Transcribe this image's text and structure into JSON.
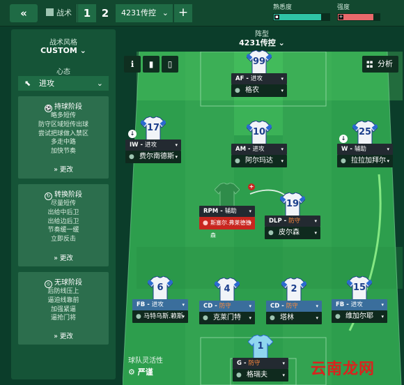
{
  "topbar": {
    "back_icon": "«",
    "tactics_tab": "战术",
    "tactic_slots": [
      "1",
      "2"
    ],
    "tactic_name": "4231传控",
    "add_label": "+",
    "familiarity_label": "熟悉度",
    "intensity_label": "强度",
    "familiarity_level": 0.85,
    "intensity_level": 0.85,
    "colors": {
      "familiarity": "#2fc4a6",
      "intensity": "#e8696b"
    }
  },
  "left_panel": {
    "style_label": "战术风格",
    "style_value": "CUSTOM",
    "mentality_label": "心态",
    "mentality_value": "进攻",
    "phases": [
      {
        "title": "持球阶段",
        "icon": "possession-icon",
        "items": [
          "略多短传",
          "防守区域短传出球",
          "尝试把球做入禁区",
          "多走中路",
          "加快节奏"
        ],
        "more": "更改"
      },
      {
        "title": "转换阶段",
        "icon": "transition-icon",
        "items": [
          "尽量短传",
          "出给中后卫",
          "出给边后卫",
          "节奏缓一缓",
          "立即反击"
        ],
        "more": "更改"
      },
      {
        "title": "无球阶段",
        "icon": "out-of-possession-icon",
        "items": [
          "后防线压上",
          "逼迫线靠前",
          "加强紧逼",
          "逼抢门将"
        ],
        "more": "更改"
      }
    ]
  },
  "pitch": {
    "formation_label": "阵型",
    "formation_value": "4231传控",
    "analysis_label": "分析",
    "flex_label": "球队灵活性",
    "flex_value": "严谨"
  },
  "players": [
    {
      "id": "af",
      "number": "99",
      "role": "AF",
      "duty": "进攻",
      "name": "格农"
    },
    {
      "id": "iw",
      "number": "17",
      "role": "IW",
      "duty": "进攻",
      "name": "费尔南德斯"
    },
    {
      "id": "am",
      "number": "10",
      "role": "AM",
      "duty": "进攻",
      "name": "阿尔玛达"
    },
    {
      "id": "w",
      "number": "25",
      "role": "W",
      "duty": "辅助",
      "name": "拉拉加拜尔"
    },
    {
      "id": "rpm",
      "number": "",
      "role": "RPM",
      "duty": "辅助",
      "name": "斯塞尔.弗莱德德森"
    },
    {
      "id": "dlp",
      "number": "19",
      "role": "DLP",
      "duty": "防守",
      "name": "皮尔森"
    },
    {
      "id": "fbl",
      "number": "6",
      "role": "FB",
      "duty": "进攻",
      "name": "马特乌斯.赖斯"
    },
    {
      "id": "cd1",
      "number": "4",
      "role": "CD",
      "duty": "防守",
      "name": "克莱门特"
    },
    {
      "id": "cd2",
      "number": "2",
      "role": "CD",
      "duty": "防守",
      "name": "塔林"
    },
    {
      "id": "fbr",
      "number": "15",
      "role": "FB",
      "duty": "进攻",
      "name": "维加尔耶"
    },
    {
      "id": "gk",
      "number": "1",
      "role": "G",
      "duty": "防守",
      "name": "格瑞夫"
    }
  ],
  "duty_colors": {
    "进攻": "#4fa3e8",
    "辅助": "#4fa3e8",
    "防守": "#ff8a3d"
  },
  "watermark": "云南龙网"
}
